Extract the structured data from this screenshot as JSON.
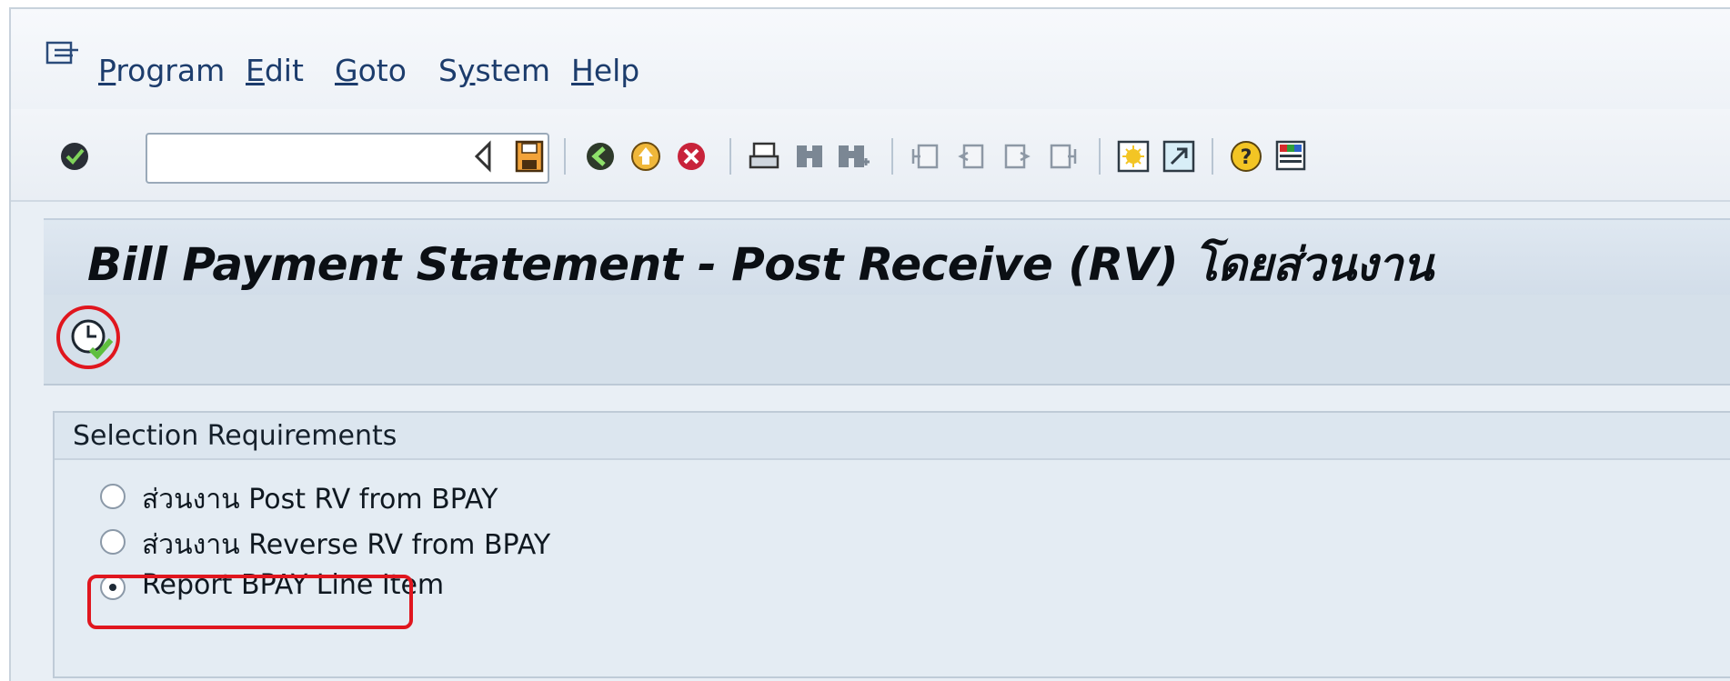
{
  "menu": {
    "items": [
      {
        "underline": "P",
        "rest": "rogram"
      },
      {
        "underline": "E",
        "rest": "dit"
      },
      {
        "underline": "G",
        "rest": "oto"
      },
      {
        "pre": "S",
        "underline": "y",
        "rest": "stem"
      },
      {
        "underline": "H",
        "rest": "elp"
      }
    ]
  },
  "toolbar": {
    "command_field_value": "",
    "icons": [
      "enter-icon",
      "back-triangle-icon",
      "save-icon",
      "back-icon",
      "exit-icon",
      "cancel-icon",
      "print-icon",
      "find-icon",
      "find-next-icon",
      "first-page-icon",
      "previous-page-icon",
      "next-page-icon",
      "last-page-icon",
      "create-session-icon",
      "shortcut-icon",
      "help-icon",
      "layout-icon"
    ]
  },
  "screen": {
    "title": "Bill Payment Statement - Post Receive (RV) โดยส่วนงาน"
  },
  "app_toolbar": {
    "execute_icon": "execute-clock-icon"
  },
  "selection": {
    "group_title": "Selection Requirements",
    "options": [
      {
        "label": "ส่วนงาน Post RV from BPAY",
        "selected": false
      },
      {
        "label": "ส่วนงาน Reverse RV from BPAY",
        "selected": false
      },
      {
        "label": "Report BPAY Line Item",
        "selected": true
      }
    ]
  },
  "colors": {
    "highlight": "#e0161e"
  }
}
